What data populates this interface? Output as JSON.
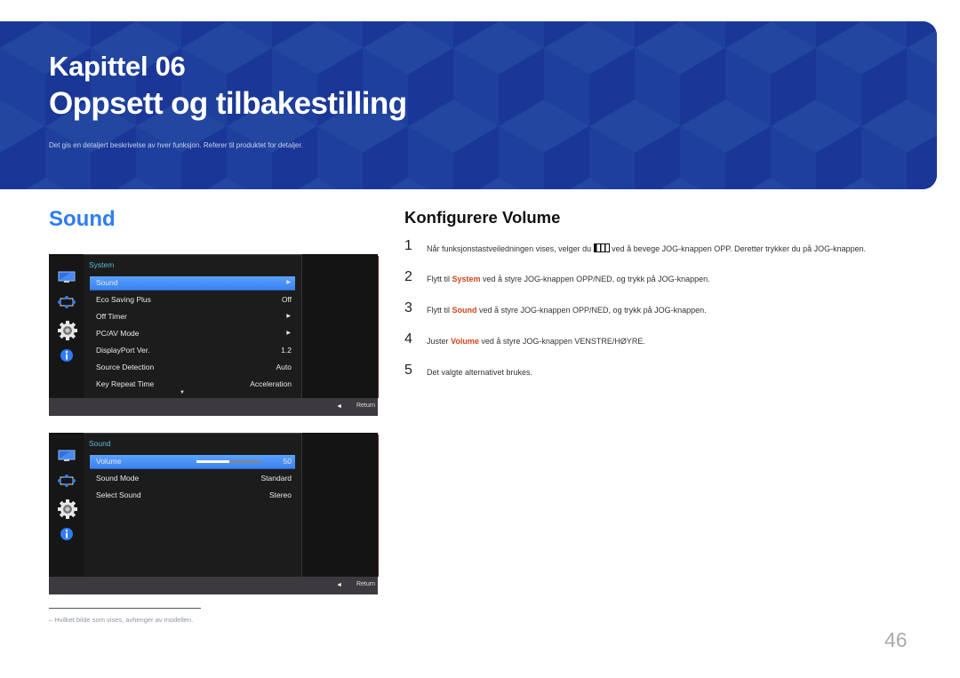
{
  "banner": {
    "chapter": "Kapittel 06",
    "title": "Oppsett og tilbakestilling",
    "description": "Det gis en detaljert beskrivelse av hver funksjon. Referer til produktet for detaljer.",
    "color": "#1f3f9e"
  },
  "section_title": "Sound",
  "osd_system": {
    "menu_title": "System",
    "items": [
      {
        "label": "Sound",
        "value": "",
        "arrow": "▶",
        "selected": true
      },
      {
        "label": "Eco Saving Plus",
        "value": "Off",
        "arrow": ""
      },
      {
        "label": "Off Timer",
        "value": "",
        "arrow": "▶"
      },
      {
        "label": "PC/AV Mode",
        "value": "",
        "arrow": "▶"
      },
      {
        "label": "DisplayPort Ver.",
        "value": "1.2",
        "arrow": ""
      },
      {
        "label": "Source Detection",
        "value": "Auto",
        "arrow": ""
      },
      {
        "label": "Key Repeat Time",
        "value": "Acceleration",
        "arrow": ""
      }
    ],
    "scroll_indicator": "▼",
    "footer": {
      "back_icon": "◄",
      "return_label": "Return"
    }
  },
  "osd_sound": {
    "menu_title": "Sound",
    "items": [
      {
        "label": "Volume",
        "value": "50",
        "selected": true,
        "slider_fraction": 0.5
      },
      {
        "label": "Sound Mode",
        "value": "Standard"
      },
      {
        "label": "Select Sound",
        "value": "Stereo"
      }
    ],
    "footer": {
      "back_icon": "◄",
      "return_label": "Return"
    }
  },
  "osd_sidebar_icons": [
    "picture-icon",
    "onscreen-display-icon",
    "system-gear-icon",
    "information-icon"
  ],
  "instructions": {
    "heading": "Konfigurere Volume",
    "steps": [
      {
        "num": "1",
        "pre": "Når funksjonstastveiledningen vises, velger du",
        "icon": "menu-keys-icon",
        "post": "ved å bevege JOG-knappen OPP. Deretter trykker du på JOG-knappen."
      },
      {
        "num": "2",
        "pre": "Flytt til ",
        "highlight": "System",
        "post": " ved å styre JOG-knappen OPP/NED, og trykk på JOG-knappen."
      },
      {
        "num": "3",
        "pre": "Flytt til ",
        "highlight": "Sound",
        "post": " ved å styre JOG-knappen OPP/NED, og trykk på JOG-knappen."
      },
      {
        "num": "4",
        "pre": "Juster ",
        "highlight": "Volume",
        "post": " ved å styre JOG-knappen VENSTRE/HØYRE."
      },
      {
        "num": "5",
        "pre": "Det valgte alternativet brukes."
      }
    ],
    "highlight_color": "#d2441c"
  },
  "footnote": "–  Hvilket bilde som vises, avhenger av modellen.",
  "page_number": "46"
}
